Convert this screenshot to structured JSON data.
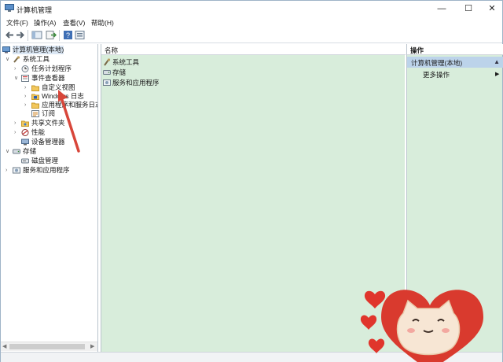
{
  "window": {
    "title": "计算机管理"
  },
  "titlebar": {
    "min_glyph": "—",
    "max_glyph": "☐",
    "close_glyph": "✕"
  },
  "menubar": {
    "items": [
      "文件(F)",
      "操作(A)",
      "查看(V)",
      "帮助(H)"
    ]
  },
  "toolbar": {
    "icons": [
      "back-arrow-icon",
      "forward-arrow-icon",
      "show-tree-icon",
      "export-icon",
      "help-icon",
      "properties-icon"
    ]
  },
  "tree": {
    "root": "计算机管理(本地)",
    "system_tools": "系统工具",
    "task_scheduler": "任务计划程序",
    "event_viewer": "事件查看器",
    "custom_views": "自定义视图",
    "windows_logs": "Windows 日志",
    "app_service_logs": "应用程序和服务日志",
    "subscriptions": "订阅",
    "shared_folders": "共享文件夹",
    "performance": "性能",
    "device_manager": "设备管理器",
    "storage": "存储",
    "disk_management": "磁盘管理",
    "services_apps": "服务和应用程序"
  },
  "main": {
    "column_header": "名称",
    "items": [
      "系统工具",
      "存储",
      "服务和应用程序"
    ]
  },
  "actions": {
    "header": "操作",
    "section": "计算机管理(本地)",
    "more": "更多操作"
  },
  "colors": {
    "pane_bg": "#d8eddb",
    "selection": "#bcd3ea",
    "arrow": "#d8463a"
  }
}
